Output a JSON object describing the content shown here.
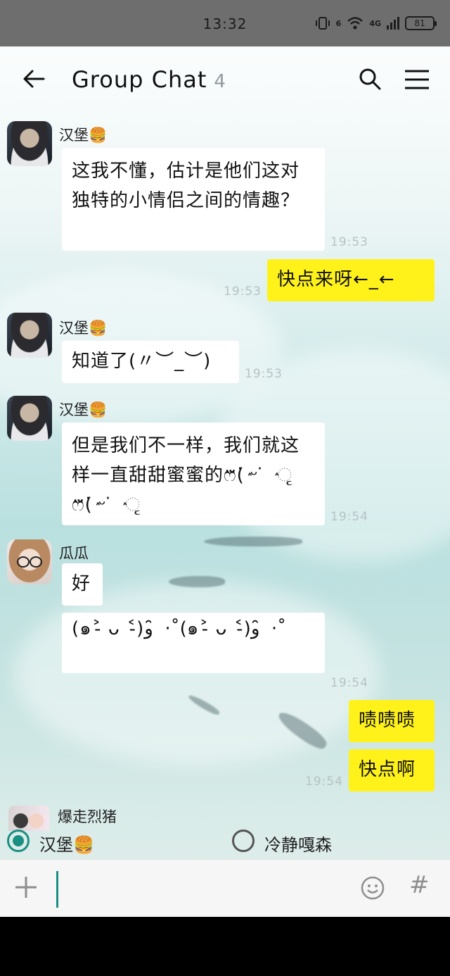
{
  "status_bar": {
    "time": "13:32",
    "network": "4G",
    "signal_prefix": "6",
    "battery": "81"
  },
  "header": {
    "title": "Group Chat",
    "member_count": "4",
    "back_icon": "back-arrow-icon",
    "search_icon": "search-icon",
    "menu_icon": "menu-icon"
  },
  "messages": [
    {
      "sender": "汉堡🍔",
      "text": "这我不懂，估计是他们这对独特的小情侣之间的情趣？",
      "time": "19:53",
      "mine": false
    },
    {
      "sender": "",
      "text": "快点来呀←_←",
      "time": "19:53",
      "mine": true
    },
    {
      "sender": "汉堡🍔",
      "text": "知道了(〃︶_︶)",
      "time": "19:53",
      "mine": false
    },
    {
      "sender": "汉堡🍔",
      "text": "但是我们不一样，我们就这样一直甜甜蜜蜜的ෆ⃛(ٛ ̇ᵕ ̇ ٛ ૃ ෆ⃛(ٛ ̇ᵕ ̇ ٛ ૃ",
      "time": "19:54",
      "mine": false
    },
    {
      "sender": "瓜瓜",
      "text": "好",
      "time": "",
      "mine": false
    },
    {
      "sender": "",
      "text": "(๑˃̵ ᴗ ˂̵)و ̑̑ ·˚(๑˃̵ ᴗ ˂̵)و ̑̑ ·˚",
      "time": "19:54",
      "mine": false
    },
    {
      "sender": "",
      "text": "啧啧啧",
      "time": "",
      "mine": true
    },
    {
      "sender": "",
      "text": "快点啊",
      "time": "19:54",
      "mine": true
    }
  ],
  "typing": {
    "name": "爆走烈猪"
  },
  "reply_options": [
    {
      "label": "汉堡🍔",
      "checked": true
    },
    {
      "label": "冷静嘎森",
      "checked": false
    }
  ],
  "input_bar": {
    "value": "",
    "plus_icon": "plus-icon",
    "emoji_icon": "emoji-icon",
    "hash_label": "#"
  },
  "colors": {
    "accent": "#1a8f84",
    "my_bubble": "#fff21b",
    "other_bubble": "#ffffff"
  }
}
